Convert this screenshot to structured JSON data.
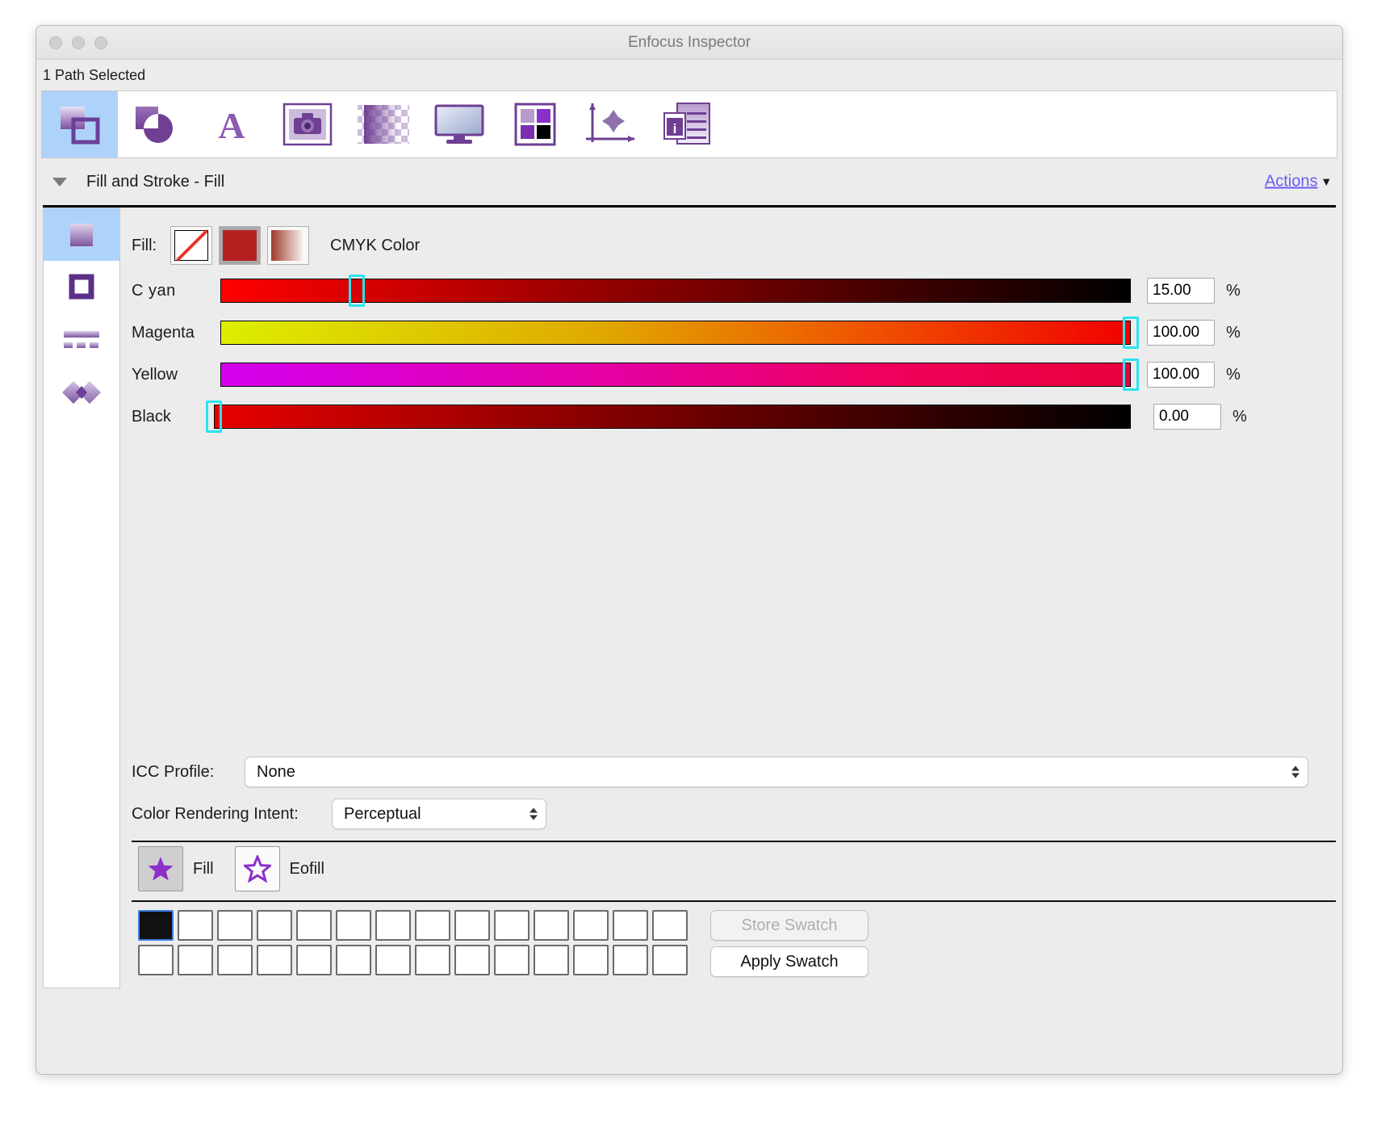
{
  "window": {
    "title": "Enfocus Inspector",
    "selection_status": "1 Path Selected"
  },
  "toolbar": {
    "items": [
      {
        "name": "fill-and-stroke",
        "label": "Fill and Stroke",
        "active": true
      },
      {
        "name": "shape",
        "label": "Shape",
        "active": false
      },
      {
        "name": "text",
        "label": "Text",
        "active": false
      },
      {
        "name": "image",
        "label": "Image",
        "active": false
      },
      {
        "name": "transparency",
        "label": "Transparency",
        "active": false
      },
      {
        "name": "separations",
        "label": "Separations",
        "active": false
      },
      {
        "name": "color",
        "label": "Color",
        "active": false
      },
      {
        "name": "position",
        "label": "Position",
        "active": false
      },
      {
        "name": "document",
        "label": "Document",
        "active": false
      }
    ]
  },
  "section": {
    "title": "Fill and Stroke - Fill",
    "actions_label": "Actions",
    "chevron": "⌄"
  },
  "rail": {
    "items": [
      {
        "name": "fill",
        "active": true
      },
      {
        "name": "stroke",
        "active": false
      },
      {
        "name": "dash",
        "active": false
      },
      {
        "name": "overprint",
        "active": false
      }
    ]
  },
  "fill": {
    "label": "Fill:",
    "mode_buttons": [
      {
        "name": "no-fill",
        "selected": false
      },
      {
        "name": "solid-color",
        "selected": true
      },
      {
        "name": "gradient",
        "selected": false
      }
    ],
    "color_space": "CMYK Color",
    "solid_color_hex": "#b32020",
    "thumb_color_hex": "#29e4f0"
  },
  "chart_data": {
    "type": "bar",
    "title": "CMYK Color Channels",
    "categories": [
      "Cyan",
      "Magenta",
      "Yellow",
      "Black"
    ],
    "values": [
      15.0,
      100.0,
      100.0,
      0.0
    ],
    "unit": "%",
    "ylim": [
      0,
      100
    ]
  },
  "sliders": [
    {
      "name": "cyan",
      "label": "C yan",
      "value": "15.00",
      "percent": 15,
      "unit": "%",
      "gradient_from": "#fe0000",
      "gradient_to": "#000000"
    },
    {
      "name": "magenta",
      "label": "Magenta",
      "value": "100.00",
      "percent": 100,
      "unit": "%",
      "gradient_from": "#ddee00",
      "gradient_to": "#f10000"
    },
    {
      "name": "yellow",
      "label": "Yellow",
      "value": "100.00",
      "percent": 100,
      "unit": "%",
      "gradient_from": "#d400ee",
      "gradient_to": "#e8003c"
    },
    {
      "name": "black",
      "label": "Black",
      "value": "0.00",
      "percent": 0,
      "unit": "%",
      "gradient_from": "#e60000",
      "gradient_to": "#000000"
    }
  ],
  "icc": {
    "label": "ICC Profile:",
    "value": "None"
  },
  "intent": {
    "label": "Color Rendering Intent:",
    "value": "Perceptual"
  },
  "fill_mode": {
    "fill_label": "Fill",
    "eofill_label": "Eofill",
    "selected": "Fill"
  },
  "swatches": {
    "store_label": "Store Swatch",
    "apply_label": "Apply Swatch",
    "store_enabled": false,
    "apply_enabled": true,
    "columns": 14,
    "rows": 2,
    "cells": [
      {
        "color": "#111111",
        "selected": true
      },
      {
        "color": "",
        "selected": false
      },
      {
        "color": "",
        "selected": false
      },
      {
        "color": "",
        "selected": false
      },
      {
        "color": "",
        "selected": false
      },
      {
        "color": "",
        "selected": false
      },
      {
        "color": "",
        "selected": false
      },
      {
        "color": "",
        "selected": false
      },
      {
        "color": "",
        "selected": false
      },
      {
        "color": "",
        "selected": false
      },
      {
        "color": "",
        "selected": false
      },
      {
        "color": "",
        "selected": false
      },
      {
        "color": "",
        "selected": false
      },
      {
        "color": "",
        "selected": false
      },
      {
        "color": "",
        "selected": false
      },
      {
        "color": "",
        "selected": false
      },
      {
        "color": "",
        "selected": false
      },
      {
        "color": "",
        "selected": false
      },
      {
        "color": "",
        "selected": false
      },
      {
        "color": "",
        "selected": false
      },
      {
        "color": "",
        "selected": false
      },
      {
        "color": "",
        "selected": false
      },
      {
        "color": "",
        "selected": false
      },
      {
        "color": "",
        "selected": false
      },
      {
        "color": "",
        "selected": false
      },
      {
        "color": "",
        "selected": false
      },
      {
        "color": "",
        "selected": false
      },
      {
        "color": "",
        "selected": false
      }
    ]
  }
}
